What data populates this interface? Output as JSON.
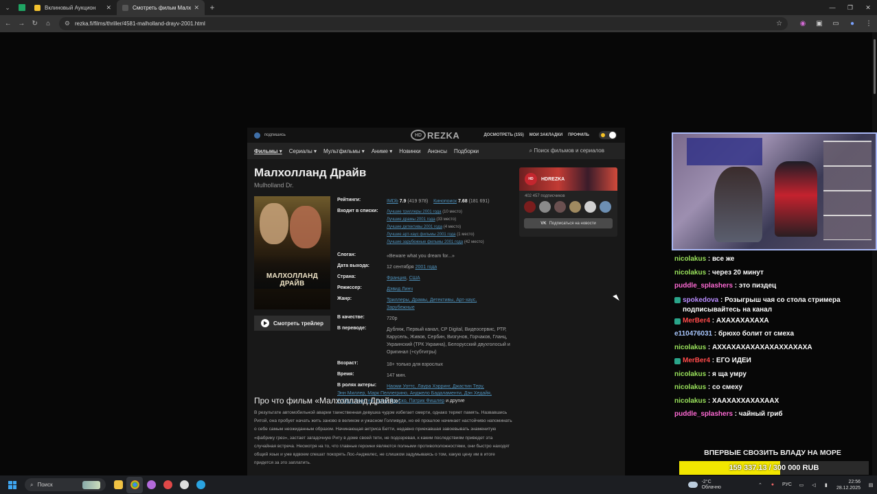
{
  "browser": {
    "tabs": [
      {
        "title": "Вклиновый Аукцион",
        "favicon_color": "#f2c12e",
        "active": false
      },
      {
        "title": "Смотреть фильм Малхолланд",
        "favicon_color": "#444444",
        "active": true
      }
    ],
    "url": "rezka.fi/films/thriller/4581-malholland-drayv-2001.html"
  },
  "site": {
    "subscribe": "подпишись",
    "logo_hd": "HD",
    "logo_text": "REZKA",
    "top_links": {
      "watchlater": "ДОСМОТРЕТЬ (155)",
      "bookmarks": "МОИ ЗАКЛАДКИ",
      "profile": "ПРОФИЛЬ"
    },
    "nav": [
      {
        "label": "Фильмы ▾",
        "active": true
      },
      {
        "label": "Сериалы ▾",
        "active": false
      },
      {
        "label": "Мультфильмы ▾",
        "active": false
      },
      {
        "label": "Аниме ▾",
        "active": false
      },
      {
        "label": "Новинки",
        "active": false
      },
      {
        "label": "Анонсы",
        "active": false
      },
      {
        "label": "Подборки",
        "active": false
      }
    ],
    "search_placeholder": "Поиск фильмов и сериалов"
  },
  "film": {
    "title": "Малхолланд Драйв",
    "original_title": "Mulholland Dr.",
    "poster_title": "МАЛХОЛЛАНД ДРАЙВ",
    "trailer_label": "Смотреть трейлер",
    "labels": {
      "ratings": "Рейтинги:",
      "lists": "Входит в списки:",
      "slogan": "Слоган:",
      "release": "Дата выхода:",
      "country": "Страна:",
      "director": "Режиссер:",
      "genre": "Жанр:",
      "quality": "В качестве:",
      "translation": "В переводе:",
      "age": "Возраст:",
      "duration": "Время:",
      "cast": "В ролях актеры:"
    },
    "ratings": {
      "imdb_label": "IMDb",
      "imdb_value": "7.9",
      "imdb_votes": "(419 978)",
      "kp_label": "Кинопоиск",
      "kp_value": "7.68",
      "kp_votes": "(181 691)"
    },
    "lists": [
      {
        "name": "Лучшие триллеры 2001 года",
        "place": "(10 место)"
      },
      {
        "name": "Лучшие драмы 2001 года",
        "place": "(33 место)"
      },
      {
        "name": "Лучшие детективы 2001 года",
        "place": "(4 место)"
      },
      {
        "name": "Лучшие арт-хаус фильмы 2001 года",
        "place": "(1 место)"
      },
      {
        "name": "Лучшие зарубежные фильмы 2001 года",
        "place": "(42 место)"
      }
    ],
    "slogan": "«Beware what you dream for...»",
    "release_day": "12 сентября",
    "release_year": "2001 года",
    "countries": [
      "Франция",
      "США"
    ],
    "director": "Дэвид Линч",
    "genres_line1": "Триллеры, Драмы, Детективы, Арт-хаус,",
    "genres_line2": "Зарубежные",
    "quality": "720p",
    "translation": "Дубляж, Первый канал, CP Digital, Видеосервис, РТР, Карусель, Живов, Сербин, Визгунов, Горчаков, Гланц, Украинский (ТРК Украина), Белорусский двухголосый и Оригинал (+субтитры)",
    "age": "18+ только для взрослых",
    "duration": "147 мин.",
    "cast_line1": "Наоми Уоттс, Лаура Хэрринг, Джастин Теру,",
    "cast_line2": "Энн Миллер, Марк Пеллегрино, Анджело Бадаламенти, Дэн Хедайя,",
    "cast_line3": "Роберт Форстер, Брент Бриско, Патрик Фишлер",
    "cast_more": "и другие",
    "about_title": "Про что фильм «Малхолланд Драйв»:",
    "about_text": "В результате автомобильной аварии таинственная девушка чудом избегает смерти, однако теряет память. Назвавшись Ритой, она пробует начать жить заново в великом и ужасном Голливуде, но её прошлое начинает настойчиво напоминать о себе самым неожиданным образом. Начинающая актриса Бетти, недавно приехавшая завоевывать знаменитую «фабрику грез», застает загадочную Риту в доме своей тети, не подозревая, к каким последствиям приведет эта случайная встреча. Несмотря на то, что главные героини являются полными противоположностями, они быстро находят общий язык и уже вдвоем спешат покорять Лос-Анджелес, не слишком задумываясь о том, какую цену им в итоге придется за это заплатить."
  },
  "social": {
    "name": "HDREZKA",
    "avatar_text": "HD",
    "subscribers": "402 457 подписчиков",
    "button": "Подписаться на новости"
  },
  "chat": [
    {
      "user": "nicolakus",
      "color": "#9be45c",
      "text": "все же",
      "badge": false
    },
    {
      "user": "nicolakus",
      "color": "#9be45c",
      "text": "через 20 минут",
      "badge": false
    },
    {
      "user": "puddle_splashers",
      "color": "#ff6ad5",
      "text": "это пиздец",
      "badge": false
    },
    {
      "user": "spokedova",
      "color": "#b98cff",
      "text": "Розыгрыш чая со стола стримера подписывайтесь на канал",
      "badge": true
    },
    {
      "user": "MerBer4",
      "color": "#ff4a4a",
      "text": "АХАХАХАХАХА",
      "badge": true
    },
    {
      "user": "e110476031",
      "color": "#aac8ff",
      "text": "брюхо болит от смеха",
      "badge": false
    },
    {
      "user": "nicolakus",
      "color": "#9be45c",
      "text": "АХХАХАХАХАХАХАХХАХАХА",
      "badge": false
    },
    {
      "user": "MerBer4",
      "color": "#ff4a4a",
      "text": "ЕГО ИДЕИ",
      "badge": true
    },
    {
      "user": "nicolakus",
      "color": "#9be45c",
      "text": "я ща умру",
      "badge": false
    },
    {
      "user": "nicolakus",
      "color": "#9be45c",
      "text": "со смеху",
      "badge": false
    },
    {
      "user": "nicolakus",
      "color": "#9be45c",
      "text": "ХААХАХХАХАХААХ",
      "badge": false
    },
    {
      "user": "puddle_splashers",
      "color": "#ff6ad5",
      "text": "чайный гриб",
      "badge": false
    }
  ],
  "goal": {
    "title": "ВПЕРВЫЕ СВОЗИТЬ ВЛАДУ НА МОРЕ",
    "text": "159 337.13 / 300 000 RUB",
    "current": 159337.13,
    "target": 300000
  },
  "taskbar": {
    "search": "Поиск",
    "weather_temp": "-2°C",
    "weather_desc": "Облачно",
    "lang": "РУС",
    "time": "22:56",
    "date": "28.12.2025"
  }
}
